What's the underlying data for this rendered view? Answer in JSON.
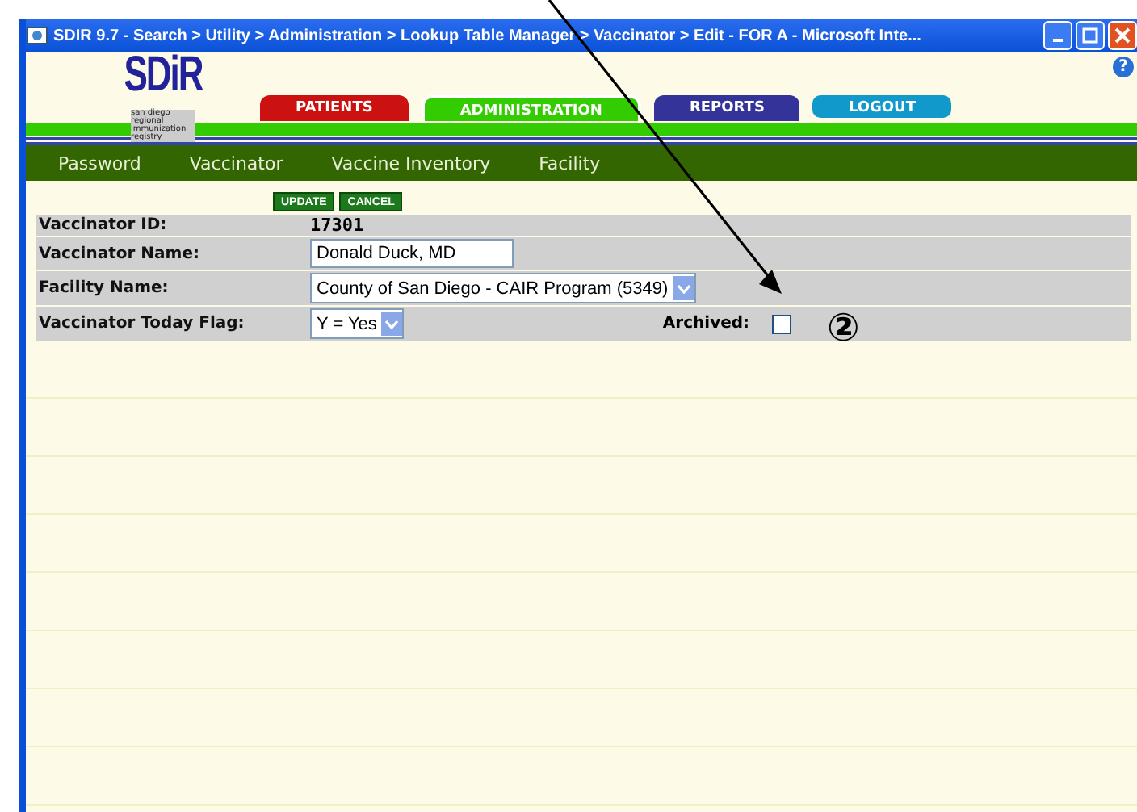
{
  "window": {
    "title": "SDIR 9.7 - Search > Utility > Administration > Lookup Table Manager > Vaccinator > Edit - FOR A - Microsoft Inte..."
  },
  "logo": {
    "text": "SDiR",
    "subtitle": "san diego regional immunization registry"
  },
  "help": "?",
  "tabs": [
    {
      "label": "PATIENTS",
      "selected": false,
      "color": "#cc1111"
    },
    {
      "label": "ADMINISTRATION",
      "selected": true,
      "color": "#33cc00"
    },
    {
      "label": "REPORTS",
      "selected": false,
      "color": "#333399"
    },
    {
      "label": "LOGOUT",
      "selected": false,
      "color": "#1199cc"
    }
  ],
  "subnav": [
    "Password",
    "Vaccinator",
    "Vaccine Inventory",
    "Facility"
  ],
  "actions": [
    "UPDATE",
    "CANCEL"
  ],
  "form": {
    "id_label": "Vaccinator ID:",
    "id_value": "17301",
    "name_label": "Vaccinator Name:",
    "name_value": "Donald Duck, MD",
    "facility_label": "Facility Name:",
    "facility_value": "County of San Diego - CAIR Program (5349)",
    "flag_label": "Vaccinator Today Flag:",
    "flag_value": "Y = Yes",
    "archived_label": "Archived:",
    "archived": false
  },
  "callout": "②"
}
